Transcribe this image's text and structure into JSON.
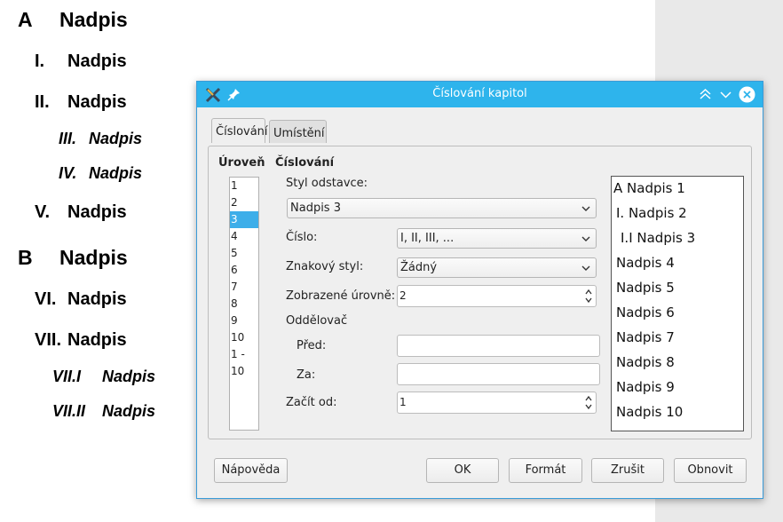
{
  "document": {
    "headings": [
      {
        "num": "A",
        "text": "Nadpis"
      },
      {
        "num": "I.",
        "text": "Nadpis"
      },
      {
        "num": "II.",
        "text": "Nadpis"
      },
      {
        "num": "III.",
        "text": "Nadpis"
      },
      {
        "num": "IV.",
        "text": "Nadpis"
      },
      {
        "num": "V.",
        "text": "Nadpis"
      },
      {
        "num": "B",
        "text": "Nadpis"
      },
      {
        "num": "VI.",
        "text": "Nadpis"
      },
      {
        "num": "VII.",
        "text": "Nadpis"
      },
      {
        "num": "VII.I",
        "text": "Nadpis"
      },
      {
        "num": "VII.II",
        "text": "Nadpis"
      }
    ]
  },
  "dialog": {
    "title": "Číslování kapitol",
    "tabs": [
      {
        "label": "Číslování",
        "active": true
      },
      {
        "label": "Umístění",
        "active": false
      }
    ],
    "level_header": "Úroveň",
    "numbering_header": "Číslování",
    "levels": [
      "1",
      "2",
      "3",
      "4",
      "5",
      "6",
      "7",
      "8",
      "9",
      "10",
      "1 - 10"
    ],
    "selected_level": "3",
    "paragraph_style_label": "Styl odstavce:",
    "paragraph_style_value": "Nadpis 3",
    "number_label": "Číslo:",
    "number_value": "I, II, III, ...",
    "char_style_label": "Znakový styl:",
    "char_style_value": "Žádný",
    "shown_levels_label": "Zobrazené úrovně:",
    "shown_levels_value": "2",
    "separator_label": "Oddělovač",
    "before_label": "Před:",
    "before_value": "",
    "after_label": "Za:",
    "after_value": "",
    "start_at_label": "Začít od:",
    "start_at_value": "1",
    "preview": [
      "A Nadpis 1",
      "I. Nadpis 2",
      "I.I Nadpis 3",
      "Nadpis 4",
      "Nadpis 5",
      "Nadpis 6",
      "Nadpis 7",
      "Nadpis 8",
      "Nadpis 9",
      "Nadpis 10"
    ],
    "buttons": {
      "help": "Nápověda",
      "ok": "OK",
      "format": "Formát",
      "cancel": "Zrušit",
      "reset": "Obnovit"
    },
    "colors": {
      "titlebar": "#2eb4ec",
      "selection": "#3daee9"
    }
  }
}
